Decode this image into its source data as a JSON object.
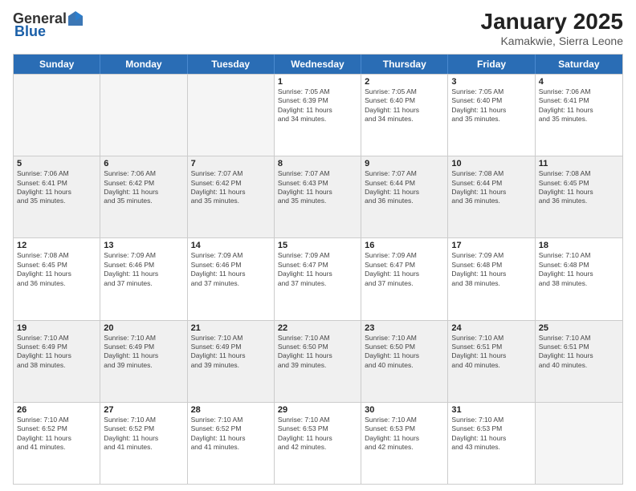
{
  "header": {
    "logo_general": "General",
    "logo_blue": "Blue",
    "title": "January 2025",
    "location": "Kamakwie, Sierra Leone"
  },
  "weekdays": [
    "Sunday",
    "Monday",
    "Tuesday",
    "Wednesday",
    "Thursday",
    "Friday",
    "Saturday"
  ],
  "rows": [
    [
      {
        "day": "",
        "info": "",
        "empty": true
      },
      {
        "day": "",
        "info": "",
        "empty": true
      },
      {
        "day": "",
        "info": "",
        "empty": true
      },
      {
        "day": "1",
        "info": "Sunrise: 7:05 AM\nSunset: 6:39 PM\nDaylight: 11 hours\nand 34 minutes."
      },
      {
        "day": "2",
        "info": "Sunrise: 7:05 AM\nSunset: 6:40 PM\nDaylight: 11 hours\nand 34 minutes."
      },
      {
        "day": "3",
        "info": "Sunrise: 7:05 AM\nSunset: 6:40 PM\nDaylight: 11 hours\nand 35 minutes."
      },
      {
        "day": "4",
        "info": "Sunrise: 7:06 AM\nSunset: 6:41 PM\nDaylight: 11 hours\nand 35 minutes."
      }
    ],
    [
      {
        "day": "5",
        "info": "Sunrise: 7:06 AM\nSunset: 6:41 PM\nDaylight: 11 hours\nand 35 minutes.",
        "shaded": true
      },
      {
        "day": "6",
        "info": "Sunrise: 7:06 AM\nSunset: 6:42 PM\nDaylight: 11 hours\nand 35 minutes.",
        "shaded": true
      },
      {
        "day": "7",
        "info": "Sunrise: 7:07 AM\nSunset: 6:42 PM\nDaylight: 11 hours\nand 35 minutes.",
        "shaded": true
      },
      {
        "day": "8",
        "info": "Sunrise: 7:07 AM\nSunset: 6:43 PM\nDaylight: 11 hours\nand 35 minutes.",
        "shaded": true
      },
      {
        "day": "9",
        "info": "Sunrise: 7:07 AM\nSunset: 6:44 PM\nDaylight: 11 hours\nand 36 minutes.",
        "shaded": true
      },
      {
        "day": "10",
        "info": "Sunrise: 7:08 AM\nSunset: 6:44 PM\nDaylight: 11 hours\nand 36 minutes.",
        "shaded": true
      },
      {
        "day": "11",
        "info": "Sunrise: 7:08 AM\nSunset: 6:45 PM\nDaylight: 11 hours\nand 36 minutes.",
        "shaded": true
      }
    ],
    [
      {
        "day": "12",
        "info": "Sunrise: 7:08 AM\nSunset: 6:45 PM\nDaylight: 11 hours\nand 36 minutes."
      },
      {
        "day": "13",
        "info": "Sunrise: 7:09 AM\nSunset: 6:46 PM\nDaylight: 11 hours\nand 37 minutes."
      },
      {
        "day": "14",
        "info": "Sunrise: 7:09 AM\nSunset: 6:46 PM\nDaylight: 11 hours\nand 37 minutes."
      },
      {
        "day": "15",
        "info": "Sunrise: 7:09 AM\nSunset: 6:47 PM\nDaylight: 11 hours\nand 37 minutes."
      },
      {
        "day": "16",
        "info": "Sunrise: 7:09 AM\nSunset: 6:47 PM\nDaylight: 11 hours\nand 37 minutes."
      },
      {
        "day": "17",
        "info": "Sunrise: 7:09 AM\nSunset: 6:48 PM\nDaylight: 11 hours\nand 38 minutes."
      },
      {
        "day": "18",
        "info": "Sunrise: 7:10 AM\nSunset: 6:48 PM\nDaylight: 11 hours\nand 38 minutes."
      }
    ],
    [
      {
        "day": "19",
        "info": "Sunrise: 7:10 AM\nSunset: 6:49 PM\nDaylight: 11 hours\nand 38 minutes.",
        "shaded": true
      },
      {
        "day": "20",
        "info": "Sunrise: 7:10 AM\nSunset: 6:49 PM\nDaylight: 11 hours\nand 39 minutes.",
        "shaded": true
      },
      {
        "day": "21",
        "info": "Sunrise: 7:10 AM\nSunset: 6:49 PM\nDaylight: 11 hours\nand 39 minutes.",
        "shaded": true
      },
      {
        "day": "22",
        "info": "Sunrise: 7:10 AM\nSunset: 6:50 PM\nDaylight: 11 hours\nand 39 minutes.",
        "shaded": true
      },
      {
        "day": "23",
        "info": "Sunrise: 7:10 AM\nSunset: 6:50 PM\nDaylight: 11 hours\nand 40 minutes.",
        "shaded": true
      },
      {
        "day": "24",
        "info": "Sunrise: 7:10 AM\nSunset: 6:51 PM\nDaylight: 11 hours\nand 40 minutes.",
        "shaded": true
      },
      {
        "day": "25",
        "info": "Sunrise: 7:10 AM\nSunset: 6:51 PM\nDaylight: 11 hours\nand 40 minutes.",
        "shaded": true
      }
    ],
    [
      {
        "day": "26",
        "info": "Sunrise: 7:10 AM\nSunset: 6:52 PM\nDaylight: 11 hours\nand 41 minutes."
      },
      {
        "day": "27",
        "info": "Sunrise: 7:10 AM\nSunset: 6:52 PM\nDaylight: 11 hours\nand 41 minutes."
      },
      {
        "day": "28",
        "info": "Sunrise: 7:10 AM\nSunset: 6:52 PM\nDaylight: 11 hours\nand 41 minutes."
      },
      {
        "day": "29",
        "info": "Sunrise: 7:10 AM\nSunset: 6:53 PM\nDaylight: 11 hours\nand 42 minutes."
      },
      {
        "day": "30",
        "info": "Sunrise: 7:10 AM\nSunset: 6:53 PM\nDaylight: 11 hours\nand 42 minutes."
      },
      {
        "day": "31",
        "info": "Sunrise: 7:10 AM\nSunset: 6:53 PM\nDaylight: 11 hours\nand 43 minutes."
      },
      {
        "day": "",
        "info": "",
        "empty": true
      }
    ]
  ]
}
